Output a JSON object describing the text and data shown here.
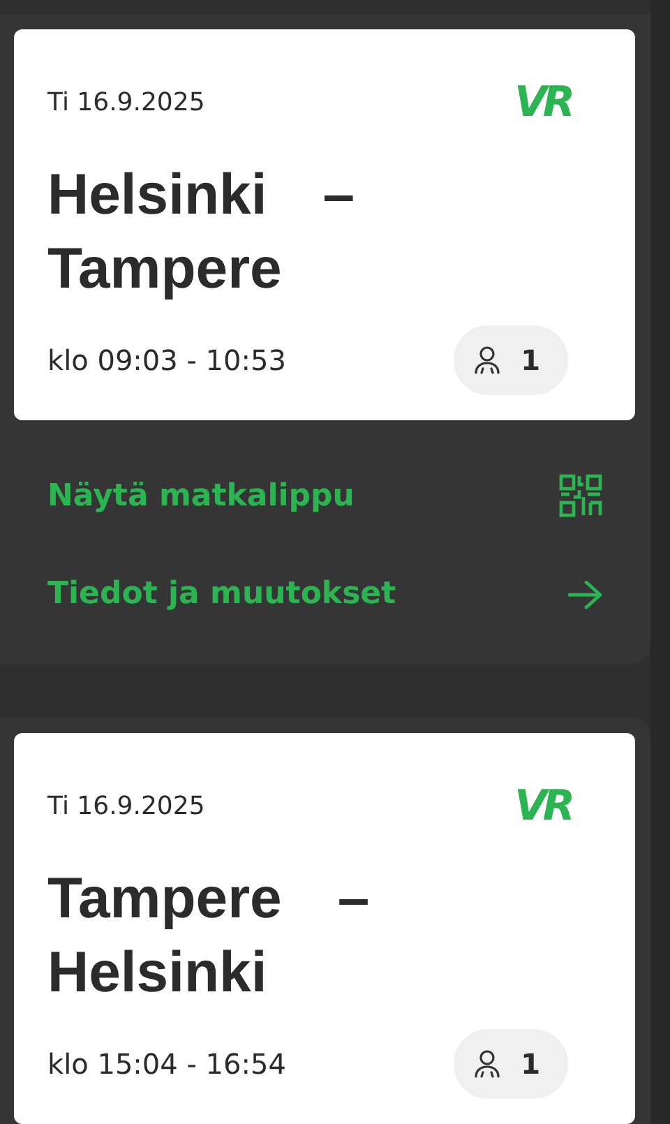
{
  "trips": [
    {
      "date": "Ti 16.9.2025",
      "logo": "VR",
      "from": "Helsinki",
      "separator": "–",
      "to": "Tampere",
      "time": "klo 09:03 - 10:53",
      "passengers": "1",
      "actions": [
        {
          "label": "Näytä matkalippu",
          "kind": "qr"
        },
        {
          "label": "Tiedot ja muutokset",
          "kind": "arrow"
        }
      ]
    },
    {
      "date": "Ti 16.9.2025",
      "logo": "VR",
      "from": "Tampere",
      "separator": "–",
      "to": "Helsinki",
      "time": "klo 15:04 - 16:54",
      "passengers": "1"
    }
  ]
}
